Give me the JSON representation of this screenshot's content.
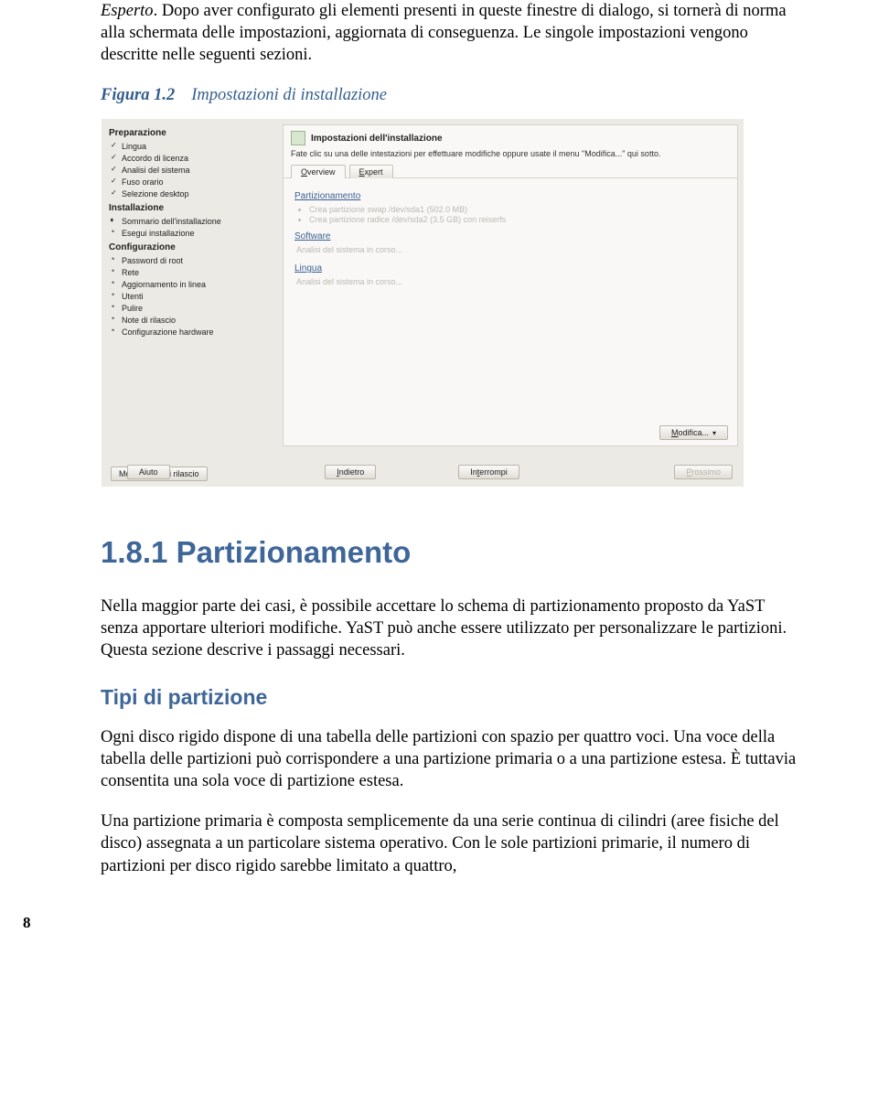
{
  "intro": {
    "emphasis": "Esperto",
    "text": ". Dopo aver configurato gli elementi presenti in queste finestre di dialogo, si tornerà di norma alla schermata delle impostazioni, aggiornata di conseguenza. Le singole impostazioni vengono descritte nelle seguenti sezioni."
  },
  "figure": {
    "number": "Figura 1.2",
    "caption": "Impostazioni di installazione"
  },
  "shot": {
    "sidebar": {
      "group1": "Preparazione",
      "items1": [
        "Lingua",
        "Accordo di licenza",
        "Analisi del sistema",
        "Fuso orario",
        "Selezione desktop"
      ],
      "group2": "Installazione",
      "items2": [
        "Sommario dell'installazione",
        "Esegui installazione"
      ],
      "group3": "Configurazione",
      "items3": [
        "Password di root",
        "Rete",
        "Aggiornamento in linea",
        "Utenti",
        "Pulire",
        "Note di rilascio",
        "Configurazione hardware"
      ],
      "notes_btn": "Mostra note di rilascio"
    },
    "main": {
      "title": "Impostazioni dell'installazione",
      "subtitle": "Fate clic su una delle intestazioni per effettuare modifiche oppure usate il menu \"Modifica...\" qui sotto.",
      "tab_overview_u": "O",
      "tab_overview_rest": "verview",
      "tab_expert_u": "E",
      "tab_expert_rest": "xpert",
      "part_head": "Partizionamento",
      "part_items": [
        "Crea partizione swap /dev/sda1 (502.0 MB)",
        "Crea partizione radice /dev/sda2 (3.5 GB) con reiserfs"
      ],
      "soft_head": "Software",
      "busy": "Analisi del sistema in corso...",
      "lang_head": "Lingua",
      "modify_u": "M",
      "modify_rest": "odifica..."
    },
    "bottom": {
      "help": "Aiuto",
      "back_u": "I",
      "back_rest": "ndietro",
      "abort_u": "I",
      "abort_pre": "n",
      "abort_u2": "t",
      "abort_rest": "errompi",
      "next_u": "P",
      "next_rest": "rossimo"
    }
  },
  "section_181": {
    "heading": "1.8.1   Partizionamento",
    "para": "Nella maggior parte dei casi, è possibile accettare lo schema di partizionamento proposto da YaST senza apportare ulteriori modifiche. YaST può anche essere utilizzato per personalizzare le partizioni. Questa sezione descrive i passaggi necessari."
  },
  "section_tipi": {
    "heading": "Tipi di partizione",
    "para1": "Ogni disco rigido dispone di una tabella delle partizioni con spazio per quattro voci. Una voce della tabella delle partizioni può corrispondere a una partizione primaria o a una partizione estesa. È tuttavia consentita una sola voce di partizione estesa.",
    "para2": "Una partizione primaria è composta semplicemente da una serie continua di cilindri (aree fisiche del disco) assegnata a un particolare sistema operativo. Con le sole partizioni primarie, il numero di partizioni per disco rigido sarebbe limitato a quattro,"
  },
  "pageno": "8"
}
